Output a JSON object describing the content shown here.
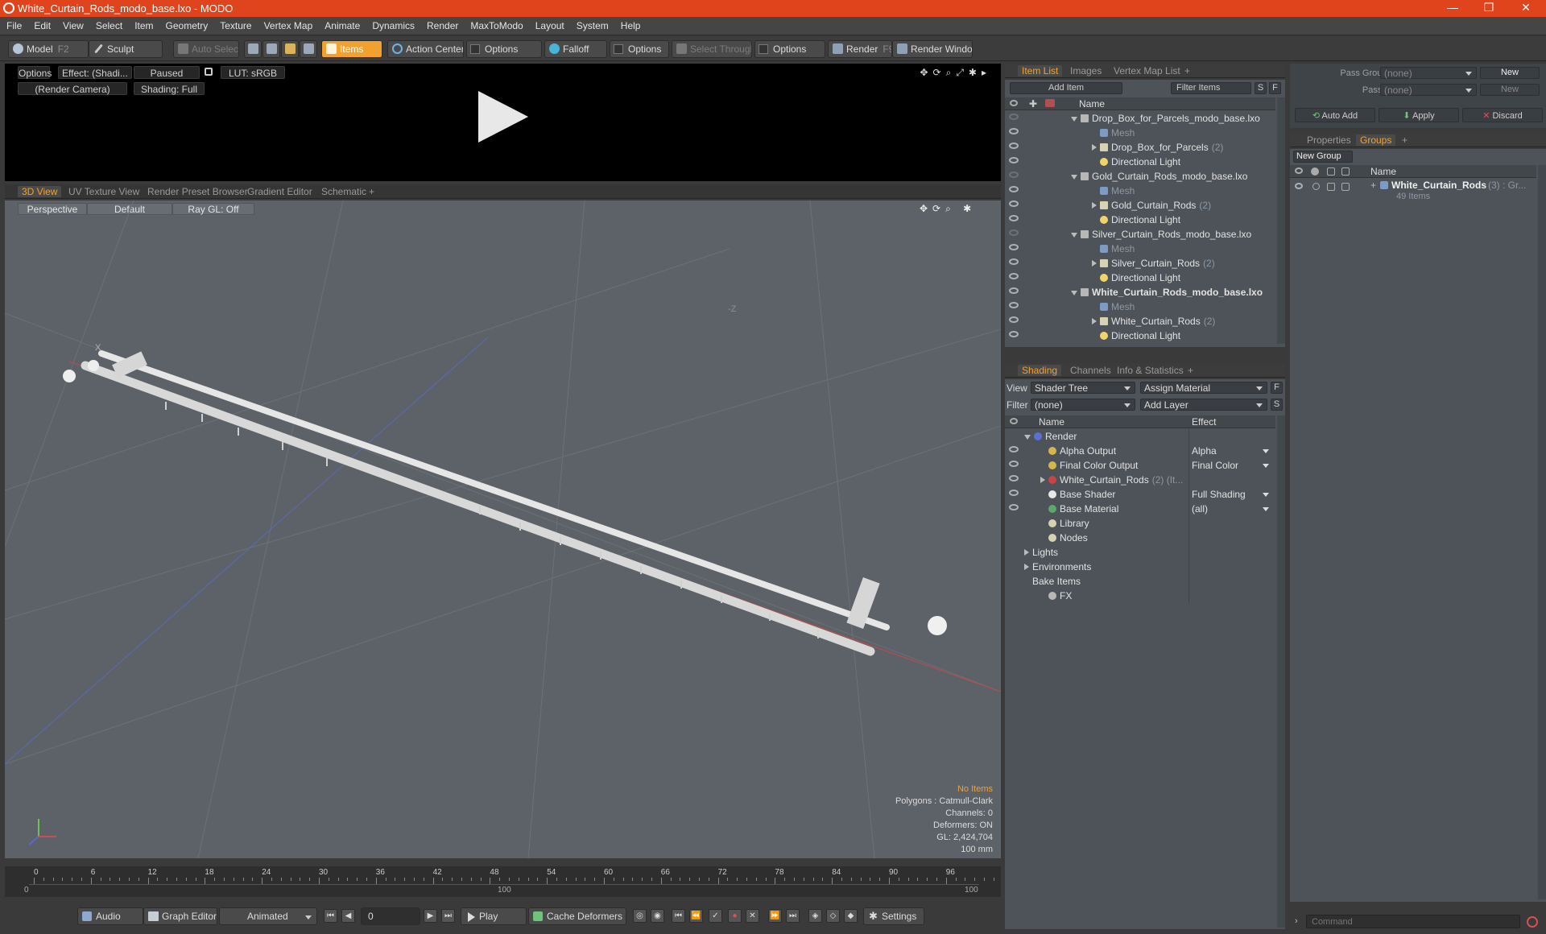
{
  "window": {
    "title": "White_Curtain_Rods_modo_base.lxo - MODO",
    "minimize": "—",
    "restore": "❐",
    "close": "✕"
  },
  "menu": [
    "File",
    "Edit",
    "View",
    "Select",
    "Item",
    "Geometry",
    "Texture",
    "Vertex Map",
    "Animate",
    "Dynamics",
    "Render",
    "MaxToModo",
    "Layout",
    "System",
    "Help"
  ],
  "toolbar": {
    "model": "Model",
    "model_key": "F2",
    "sculpt": "Sculpt",
    "auto_select": "Auto Select",
    "items": "Items",
    "action_center": "Action Center",
    "options1": "Options",
    "falloff": "Falloff",
    "options2": "Options",
    "select_through": "Select Through",
    "options3": "Options",
    "render": "Render",
    "render_key": "F9",
    "render_window": "Render Window"
  },
  "preview": {
    "options": "Options",
    "effect": "Effect: (Shadi...",
    "paused": "Paused",
    "lut": "LUT: sRGB",
    "camera": "(Render Camera)",
    "shading": "Shading: Full"
  },
  "viewport_tabs": [
    "3D View",
    "UV Texture View",
    "Render Preset Browser",
    "Gradient Editor",
    "Schematic",
    "+"
  ],
  "viewport": {
    "perspective": "Perspective",
    "default": "Default",
    "raygl": "Ray GL: Off",
    "axis_label": "-Z",
    "x_label": "X",
    "info": {
      "no_items": "No Items",
      "polygons": "Polygons : Catmull-Clark",
      "channels": "Channels: 0",
      "deformers": "Deformers: ON",
      "gl": "GL: 2,424,704",
      "scale": "100 mm"
    }
  },
  "item_list": {
    "tabs": [
      "Item List",
      "Images",
      "Vertex Map List",
      "+"
    ],
    "add_item": "Add Item",
    "filter": "Filter Items",
    "s": "S",
    "f": "F",
    "col_name": "Name",
    "rows": [
      {
        "label": "Drop_Box_for_Parcels_modo_base.lxo",
        "kind": "scene",
        "indent": 0,
        "bold": false,
        "count": ""
      },
      {
        "label": "Mesh",
        "kind": "mesh",
        "indent": 1,
        "bold": false,
        "count": ""
      },
      {
        "label": "Drop_Box_for_Parcels",
        "kind": "grp",
        "indent": 1,
        "bold": false,
        "count": "(2)"
      },
      {
        "label": "Directional Light",
        "kind": "light",
        "indent": 1,
        "bold": false,
        "count": ""
      },
      {
        "label": "Gold_Curtain_Rods_modo_base.lxo",
        "kind": "scene",
        "indent": 0,
        "bold": false,
        "count": ""
      },
      {
        "label": "Mesh",
        "kind": "mesh",
        "indent": 1,
        "bold": false,
        "count": ""
      },
      {
        "label": "Gold_Curtain_Rods",
        "kind": "grp",
        "indent": 1,
        "bold": false,
        "count": "(2)"
      },
      {
        "label": "Directional Light",
        "kind": "light",
        "indent": 1,
        "bold": false,
        "count": ""
      },
      {
        "label": "Silver_Curtain_Rods_modo_base.lxo",
        "kind": "scene",
        "indent": 0,
        "bold": false,
        "count": ""
      },
      {
        "label": "Mesh",
        "kind": "mesh",
        "indent": 1,
        "bold": false,
        "count": ""
      },
      {
        "label": "Silver_Curtain_Rods",
        "kind": "grp",
        "indent": 1,
        "bold": false,
        "count": "(2)"
      },
      {
        "label": "Directional Light",
        "kind": "light",
        "indent": 1,
        "bold": false,
        "count": ""
      },
      {
        "label": "White_Curtain_Rods_modo_base.lxo",
        "kind": "scene",
        "indent": 0,
        "bold": true,
        "count": ""
      },
      {
        "label": "Mesh",
        "kind": "mesh",
        "indent": 1,
        "bold": false,
        "count": ""
      },
      {
        "label": "White_Curtain_Rods",
        "kind": "grp",
        "indent": 1,
        "bold": false,
        "count": "(2)"
      },
      {
        "label": "Directional Light",
        "kind": "light",
        "indent": 1,
        "bold": false,
        "count": ""
      }
    ]
  },
  "shading": {
    "tabs": [
      "Shading",
      "Channels",
      "Info & Statistics",
      "+"
    ],
    "view_label": "View",
    "view_value": "Shader Tree",
    "assign": "Assign Material",
    "filter_label": "Filter",
    "filter_value": "(none)",
    "add_layer": "Add Layer",
    "f": "F",
    "s": "S",
    "col_name": "Name",
    "col_effect": "Effect",
    "rows": [
      {
        "label": "Render",
        "effect": "",
        "indent": 0,
        "color": "#5c6fd6",
        "eye": false,
        "arrow": "down"
      },
      {
        "label": "Alpha Output",
        "effect": "Alpha",
        "indent": 1,
        "color": "#d6b64a",
        "eye": true,
        "arrow": ""
      },
      {
        "label": "Final Color Output",
        "effect": "Final Color",
        "indent": 1,
        "color": "#d6b64a",
        "eye": true,
        "arrow": ""
      },
      {
        "label": "White_Curtain_Rods",
        "effect": "",
        "suffix": "(2) (It...",
        "indent": 1,
        "color": "#c94444",
        "eye": true,
        "arrow": "right"
      },
      {
        "label": "Base Shader",
        "effect": "Full Shading",
        "indent": 1,
        "color": "#e8e8e8",
        "eye": true,
        "arrow": ""
      },
      {
        "label": "Base Material",
        "effect": "(all)",
        "indent": 1,
        "color": "#5aa86a",
        "eye": true,
        "arrow": ""
      },
      {
        "label": "Library",
        "effect": "",
        "indent": 1,
        "color": "#d7d2b2",
        "eye": false,
        "arrow": ""
      },
      {
        "label": "Nodes",
        "effect": "",
        "indent": 1,
        "color": "#d7d2b2",
        "eye": false,
        "arrow": ""
      },
      {
        "label": "Lights",
        "effect": "",
        "indent": 0,
        "color": "",
        "eye": false,
        "arrow": "right"
      },
      {
        "label": "Environments",
        "effect": "",
        "indent": 0,
        "color": "",
        "eye": false,
        "arrow": "right"
      },
      {
        "label": "Bake Items",
        "effect": "",
        "indent": 0,
        "color": "",
        "eye": false,
        "arrow": ""
      },
      {
        "label": "FX",
        "effect": "",
        "indent": 1,
        "color": "#b7b7b7",
        "eye": false,
        "arrow": ""
      }
    ]
  },
  "groups": {
    "pass_groups_label": "Pass Groups",
    "pass_groups_value": "(none)",
    "passes_label": "Passes",
    "passes_value": "(none)",
    "new1": "New",
    "new2": "New",
    "auto_add": "Auto Add",
    "apply": "Apply",
    "discard": "Discard",
    "tabs": [
      "Properties",
      "Groups",
      "+"
    ],
    "new_group": "New Group",
    "col_name": "Name",
    "item_name": "White_Curtain_Rods",
    "item_count": "(3) : Gr...",
    "item_sub": "49 Items"
  },
  "timeline": {
    "ticks": [
      "0",
      "6",
      "12",
      "18",
      "24",
      "30",
      "36",
      "42",
      "48",
      "54",
      "60",
      "66",
      "72",
      "78",
      "84",
      "90",
      "96"
    ],
    "bottom_ticks": [
      "0",
      "100",
      "100"
    ]
  },
  "transport": {
    "audio": "Audio",
    "graph_editor": "Graph Editor",
    "animated": "Animated",
    "frame": "0",
    "play": "Play",
    "cache": "Cache Deformers",
    "settings": "Settings"
  },
  "command": {
    "placeholder": "Command"
  },
  "colors": {
    "accent": "#f2a12e",
    "title": "#e0441c"
  }
}
